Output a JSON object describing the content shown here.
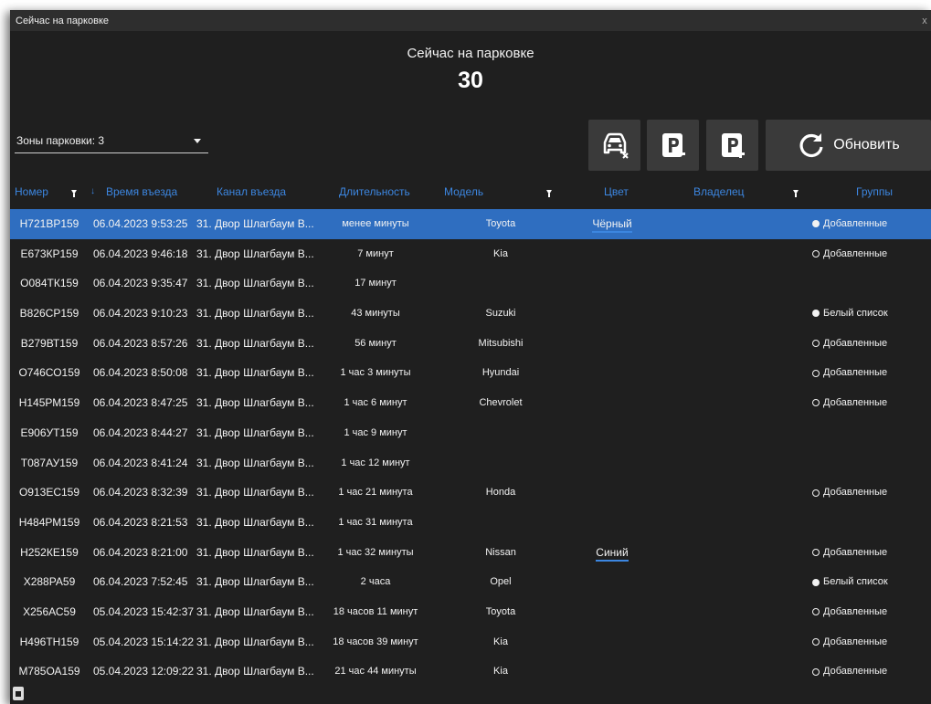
{
  "window": {
    "title": "Сейчас на парковке",
    "close": "x"
  },
  "header": {
    "title": "Сейчас на парковке",
    "count": "30"
  },
  "zone_select": {
    "label": "Зоны парковки: 3"
  },
  "toolbar": {
    "refresh_label": "Обновить"
  },
  "columns": {
    "plate": "Номер",
    "entry_time": "Время въезда",
    "entry_channel": "Канал въезда",
    "duration": "Длительность",
    "model": "Модель",
    "color": "Цвет",
    "owner": "Владелец",
    "groups": "Группы"
  },
  "accent": "#3c86e0",
  "selected_row_color": "#2f6ec0",
  "rows": [
    {
      "plate": "Н721ВР159",
      "time": "06.04.2023 9:53:25",
      "channel": "31. Двор Шлагбаум В...",
      "duration": "менее минуты",
      "model": "Toyota",
      "color": "Чёрный",
      "group": "Добавленные",
      "group_dot": "filled",
      "selected": true
    },
    {
      "plate": "Е673КР159",
      "time": "06.04.2023 9:46:18",
      "channel": "31. Двор Шлагбаум В...",
      "duration": "7 минут",
      "model": "Kia",
      "color": "",
      "group": "Добавленные",
      "group_dot": "hollow"
    },
    {
      "plate": "О084ТК159",
      "time": "06.04.2023 9:35:47",
      "channel": "31. Двор Шлагбаум В...",
      "duration": "17 минут",
      "model": "",
      "color": "",
      "group": "",
      "group_dot": ""
    },
    {
      "plate": "В826СР159",
      "time": "06.04.2023 9:10:23",
      "channel": "31. Двор Шлагбаум В...",
      "duration": "43 минуты",
      "model": "Suzuki",
      "color": "",
      "group": "Белый список",
      "group_dot": "filled"
    },
    {
      "plate": "В279ВТ159",
      "time": "06.04.2023 8:57:26",
      "channel": "31. Двор Шлагбаум В...",
      "duration": "56 минут",
      "model": "Mitsubishi",
      "color": "",
      "group": "Добавленные",
      "group_dot": "hollow"
    },
    {
      "plate": "О746СО159",
      "time": "06.04.2023 8:50:08",
      "channel": "31. Двор Шлагбаум В...",
      "duration": "1 час 3 минуты",
      "model": "Hyundai",
      "color": "",
      "group": "Добавленные",
      "group_dot": "hollow"
    },
    {
      "plate": "Н145РМ159",
      "time": "06.04.2023 8:47:25",
      "channel": "31. Двор Шлагбаум В...",
      "duration": "1 час 6 минут",
      "model": "Chevrolet",
      "color": "",
      "group": "Добавленные",
      "group_dot": "hollow"
    },
    {
      "plate": "Е906УТ159",
      "time": "06.04.2023 8:44:27",
      "channel": "31. Двор Шлагбаум В...",
      "duration": "1 час 9 минут",
      "model": "",
      "color": "",
      "group": "",
      "group_dot": ""
    },
    {
      "plate": "Т087АУ159",
      "time": "06.04.2023 8:41:24",
      "channel": "31. Двор Шлагбаум В...",
      "duration": "1 час 12 минут",
      "model": "",
      "color": "",
      "group": "",
      "group_dot": ""
    },
    {
      "plate": "О913ЕС159",
      "time": "06.04.2023 8:32:39",
      "channel": "31. Двор Шлагбаум В...",
      "duration": "1 час 21 минута",
      "model": "Honda",
      "color": "",
      "group": "Добавленные",
      "group_dot": "hollow"
    },
    {
      "plate": "Н484РМ159",
      "time": "06.04.2023 8:21:53",
      "channel": "31. Двор Шлагбаум В...",
      "duration": "1 час 31 минута",
      "model": "",
      "color": "",
      "group": "",
      "group_dot": ""
    },
    {
      "plate": "Н252КЕ159",
      "time": "06.04.2023 8:21:00",
      "channel": "31. Двор Шлагбаум В...",
      "duration": "1 час 32 минуты",
      "model": "Nissan",
      "color": "Синий",
      "group": "Добавленные",
      "group_dot": "hollow"
    },
    {
      "plate": "Х288РА59",
      "time": "06.04.2023 7:52:45",
      "channel": "31. Двор Шлагбаум В...",
      "duration": "2 часа",
      "model": "Opel",
      "color": "",
      "group": "Белый список",
      "group_dot": "filled"
    },
    {
      "plate": "Х256АС59",
      "time": "05.04.2023 15:42:37",
      "channel": "31. Двор Шлагбаум В...",
      "duration": "18 часов 11 минут",
      "model": "Toyota",
      "color": "",
      "group": "Добавленные",
      "group_dot": "hollow"
    },
    {
      "plate": "Н496ТН159",
      "time": "05.04.2023 15:14:22",
      "channel": "31. Двор Шлагбаум В...",
      "duration": "18 часов 39 минут",
      "model": "Kia",
      "color": "",
      "group": "Добавленные",
      "group_dot": "hollow"
    },
    {
      "plate": "М785ОА159",
      "time": "05.04.2023 12:09:22",
      "channel": "31. Двор Шлагбаум В...",
      "duration": "21 час 44 минуты",
      "model": "Kia",
      "color": "",
      "group": "Добавленные",
      "group_dot": "hollow"
    }
  ]
}
